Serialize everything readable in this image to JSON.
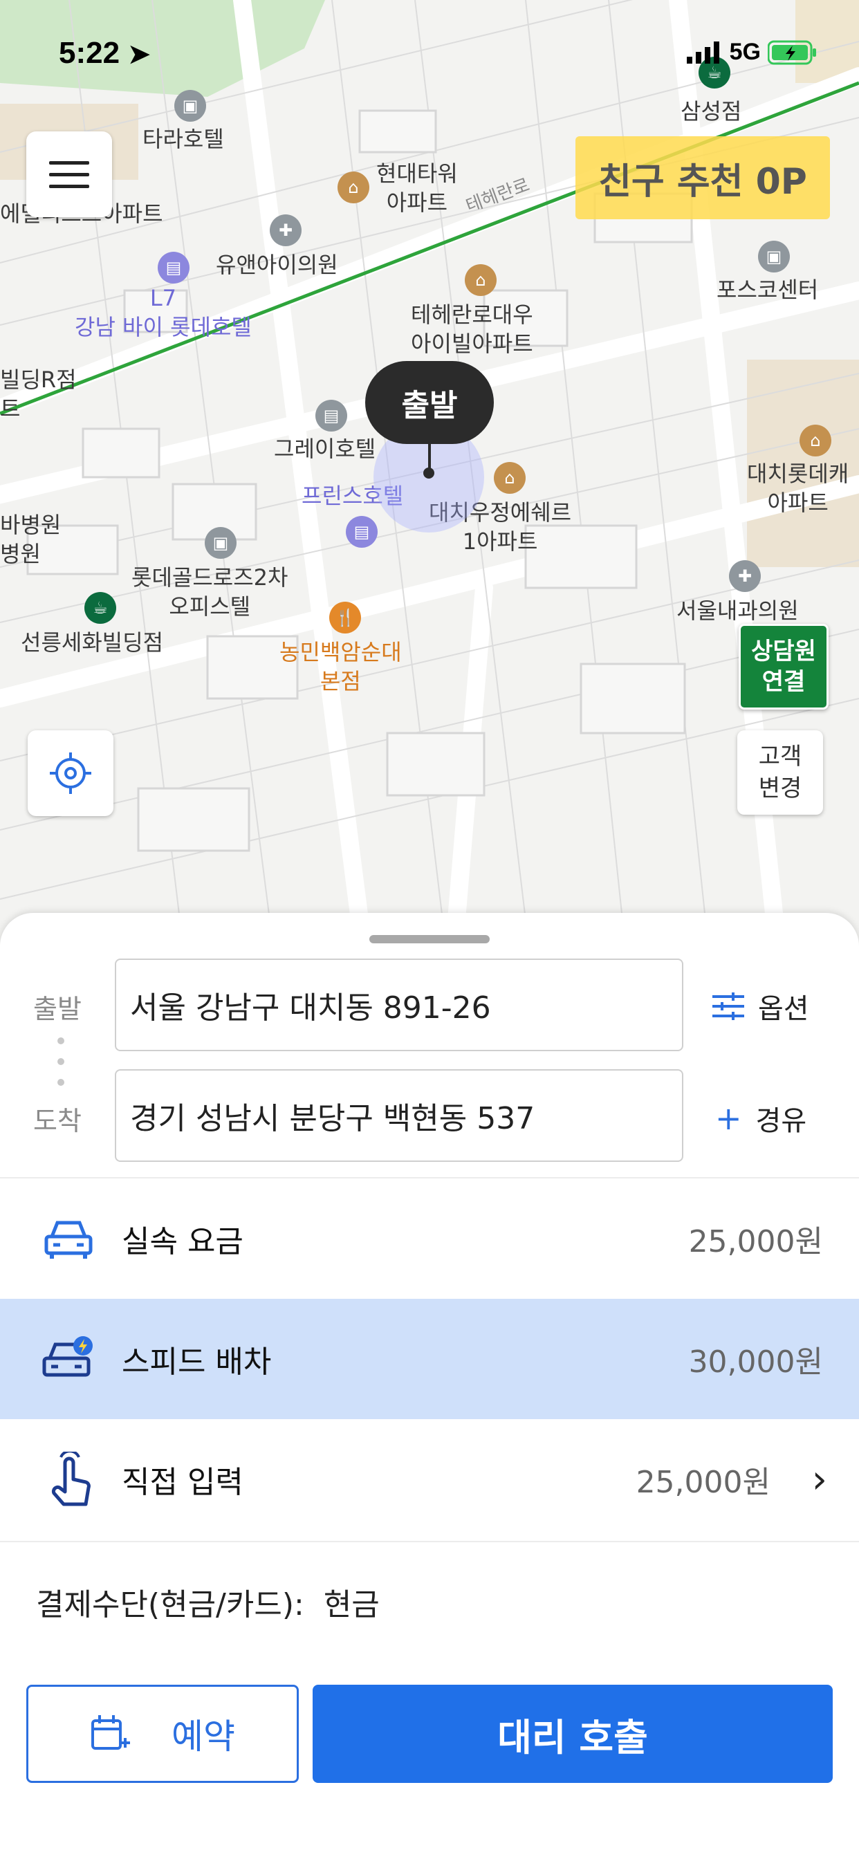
{
  "status_bar": {
    "time": "5:22",
    "network": "5G"
  },
  "map": {
    "pois": [
      {
        "name": "타라호텔"
      },
      {
        "name": "현대타워\n아파트"
      },
      {
        "name": "테헤란로"
      },
      {
        "name": "삼성점"
      },
      {
        "name": "에델리스트아파트"
      },
      {
        "name": "유앤아이의원"
      },
      {
        "name": "L7\n강남 바이 롯데호텔"
      },
      {
        "name": "포스코센터"
      },
      {
        "name": "테헤란로대우\n아이빌아파트"
      },
      {
        "name": "빌딩R점\n트"
      },
      {
        "name": "그레이호텔"
      },
      {
        "name": "프린스호텔"
      },
      {
        "name": "대치우정에쉐르\n1아파트"
      },
      {
        "name": "대치롯데캐\n아파트"
      },
      {
        "name": "바병원\n병원"
      },
      {
        "name": "롯데골드로즈2차\n오피스텔"
      },
      {
        "name": "서울내과의원"
      },
      {
        "name": "선릉세화빌딩점"
      },
      {
        "name": "농민백암순대\n본점"
      }
    ],
    "start_marker": "출발",
    "referral_banner": "친구 추천 0P",
    "counsel_button": "상담원\n연결",
    "change_customer_button": "고객\n변경"
  },
  "route": {
    "start_label": "출발",
    "start_address": "서울 강남구 대치동 891-26",
    "end_label": "도착",
    "end_address": "경기 성남시 분당구 백현동 537",
    "options_label": "옵션",
    "waypoint_label": "경유"
  },
  "fares": [
    {
      "label": "실속 요금",
      "value": "25,000원",
      "selected": false,
      "icon": "car-icon"
    },
    {
      "label": "스피드 배차",
      "value": "30,000원",
      "selected": true,
      "icon": "speed-car-icon"
    },
    {
      "label": "직접 입력",
      "value": "25,000원",
      "selected": false,
      "icon": "tap-icon"
    }
  ],
  "payment": {
    "label": "결제수단(현금/카드):",
    "value": "현금"
  },
  "actions": {
    "reserve_label": "예약",
    "call_label": "대리 호출"
  },
  "colors": {
    "primary": "#2070e8",
    "selected_row": "#cfe0fa",
    "counsel": "#14843b",
    "referral": "#ffda4f"
  }
}
